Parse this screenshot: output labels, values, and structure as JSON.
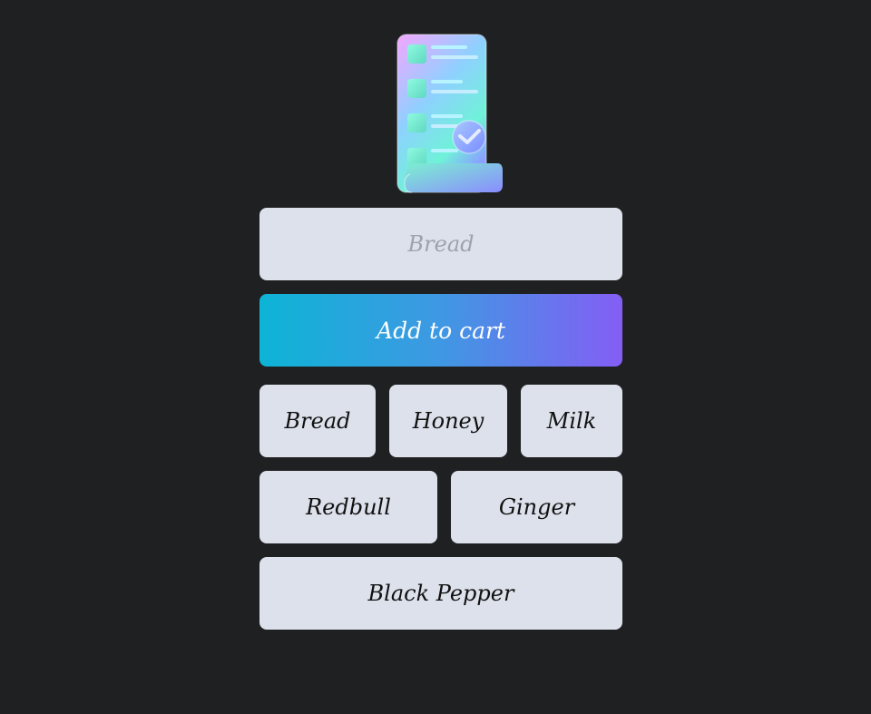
{
  "logo": {
    "icon": "checklist-receipt-icon"
  },
  "input": {
    "value": "",
    "placeholder": "Bread"
  },
  "add_button": {
    "label": "Add to cart"
  },
  "items": [
    {
      "label": "Bread"
    },
    {
      "label": "Honey"
    },
    {
      "label": "Milk"
    },
    {
      "label": "Redbull"
    },
    {
      "label": "Ginger"
    },
    {
      "label": "Black Pepper"
    }
  ],
  "colors": {
    "background": "#1f2021",
    "item_background": "#dde1eb",
    "gradient_start": "#0db4d6",
    "gradient_end": "#845ef5"
  }
}
